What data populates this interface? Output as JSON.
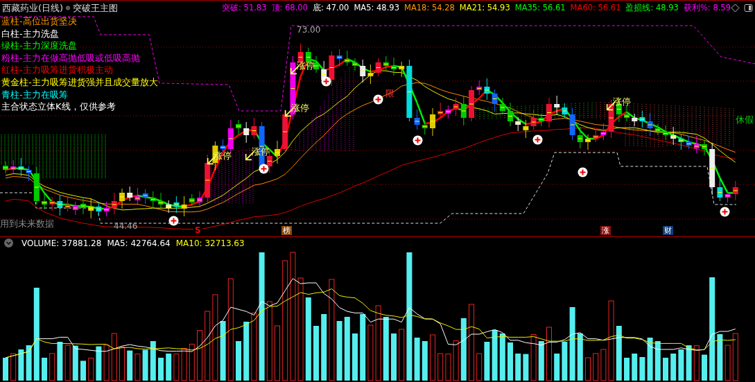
{
  "header": {
    "title": "西藏药业(日线)",
    "indicator": "突破王主图",
    "readings": [
      {
        "text": "突破: 51.83",
        "color": "#ff00ff"
      },
      {
        "text": "顶: 68.00",
        "color": "#ff00ff"
      },
      {
        "text": "底: 47.00",
        "color": "#ffffff"
      },
      {
        "text": "MA5: 48.93",
        "color": "#ffffff"
      },
      {
        "text": "MA18: 54.28",
        "color": "#ff9900"
      },
      {
        "text": "MA21: 54.93",
        "color": "#ffff00"
      },
      {
        "text": "MA35: 56.61",
        "color": "#00ff00"
      },
      {
        "text": "MA60: 56.61",
        "color": "#ff0000"
      },
      {
        "text": "盈损线: 48.93",
        "color": "#00ff00"
      },
      {
        "text": "获利%: 8.59",
        "color": "#ff00ff"
      }
    ]
  },
  "legend": [
    {
      "text": "蓝柱-高位出货坚决",
      "color": "#ff9900"
    },
    {
      "text": "白柱-主力洗盘",
      "color": "#ffffff"
    },
    {
      "text": "绿柱-主力深度洗盘",
      "color": "#00ff00"
    },
    {
      "text": "粉柱-主力在做高抛低吸或低吸高抛",
      "color": "#ff00ff"
    },
    {
      "text": "红柱-主力吸筹进货积极主动",
      "color": "#ff0000"
    },
    {
      "text": "黄金柱-主力吸筹进货强并且成交量放大",
      "color": "#ffff00"
    },
    {
      "text": "青柱-主力在吸筹",
      "color": "#00ffff"
    },
    {
      "text": "主合状态立体K线，仅供参考",
      "color": "#ffffff"
    }
  ],
  "price_chart": {
    "annotations": [
      {
        "kind": "price",
        "text": "73.00"
      },
      {
        "kind": "price",
        "text": "44.46"
      },
      {
        "kind": "note",
        "text": "用到未来数据"
      },
      {
        "kind": "limit_up",
        "text": "涨停"
      },
      {
        "kind": "limit_up",
        "text": "涨停"
      },
      {
        "kind": "limit_up",
        "text": "涨停"
      },
      {
        "kind": "limit_up",
        "text": "涨停"
      },
      {
        "kind": "limit_up",
        "text": "涨停"
      },
      {
        "kind": "limit",
        "text": "限"
      },
      {
        "kind": "holiday",
        "text": "休假"
      }
    ],
    "markers": [
      {
        "kind": "letter",
        "text": "S",
        "color": "#ff0000"
      },
      {
        "kind": "badge",
        "text": "榜",
        "color": "#8b4a10"
      },
      {
        "kind": "badge",
        "text": "涨",
        "color": "#8b1010"
      },
      {
        "kind": "badge",
        "text": "财",
        "color": "#103f7a"
      }
    ]
  },
  "volume": {
    "readings": [
      {
        "text": "VOLUME: 37881.28",
        "color": "#ffffff"
      },
      {
        "text": "MA5: 42764.64",
        "color": "#ffffff"
      },
      {
        "text": "MA10: 32713.63",
        "color": "#ffff00"
      }
    ]
  }
}
